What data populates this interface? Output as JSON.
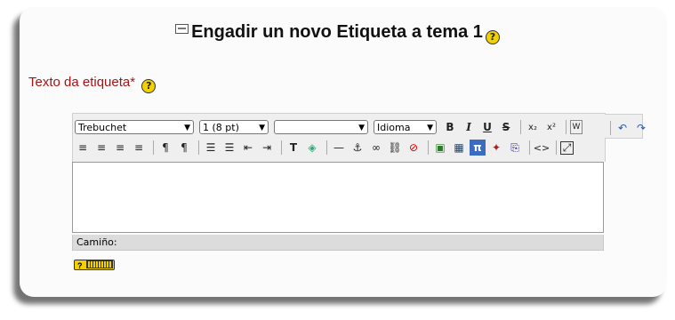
{
  "page": {
    "title": "Engadir un novo Etiqueta a tema 1",
    "help_glyph": "?"
  },
  "field": {
    "label": "Texto da etiqueta*"
  },
  "editor": {
    "font_family": "Trebuchet",
    "font_size": "1 (8 pt)",
    "format": "",
    "language": "Idioma",
    "path_label": "Camiño:",
    "content": ""
  },
  "toolbar_row1": [
    {
      "name": "bold-button",
      "glyph": "B"
    },
    {
      "name": "italic-button",
      "glyph": "I"
    },
    {
      "name": "underline-button",
      "glyph": "U"
    },
    {
      "name": "strikethrough-button",
      "glyph": "S"
    },
    {
      "name": "subscript-button",
      "glyph": "x₂"
    },
    {
      "name": "superscript-button",
      "glyph": "x²"
    },
    {
      "name": "paste-word-button",
      "glyph": "W"
    },
    {
      "name": "undo-button",
      "glyph": "↶"
    },
    {
      "name": "redo-button",
      "glyph": "↷"
    }
  ],
  "toolbar_row2": [
    {
      "name": "align-left-icon",
      "glyph": "≡"
    },
    {
      "name": "align-center-icon",
      "glyph": "≡"
    },
    {
      "name": "align-right-icon",
      "glyph": "≡"
    },
    {
      "name": "justify-icon",
      "glyph": "≡"
    },
    {
      "name": "ltr-icon",
      "glyph": "¶"
    },
    {
      "name": "rtl-icon",
      "glyph": "¶"
    },
    {
      "name": "ordered-list-icon",
      "glyph": "☰"
    },
    {
      "name": "unordered-list-icon",
      "glyph": "☰"
    },
    {
      "name": "outdent-icon",
      "glyph": "⇤"
    },
    {
      "name": "indent-icon",
      "glyph": "⇥"
    },
    {
      "name": "text-color-icon",
      "glyph": "T"
    },
    {
      "name": "background-color-icon",
      "glyph": "◈"
    },
    {
      "name": "horizontal-rule-icon",
      "glyph": "—"
    },
    {
      "name": "anchor-icon",
      "glyph": "⚓"
    },
    {
      "name": "link-icon",
      "glyph": "∞"
    },
    {
      "name": "unlink-icon",
      "glyph": "⛓"
    },
    {
      "name": "nolink-icon",
      "glyph": "⊘"
    },
    {
      "name": "image-icon",
      "glyph": "▣"
    },
    {
      "name": "table-icon",
      "glyph": "▦"
    },
    {
      "name": "math-icon",
      "glyph": "π"
    },
    {
      "name": "special-char-icon",
      "glyph": "✦"
    },
    {
      "name": "search-replace-icon",
      "glyph": "⎘"
    },
    {
      "name": "html-source-icon",
      "glyph": "<>"
    },
    {
      "name": "fullscreen-icon",
      "glyph": "⤢"
    }
  ],
  "keyboard_help": "?"
}
